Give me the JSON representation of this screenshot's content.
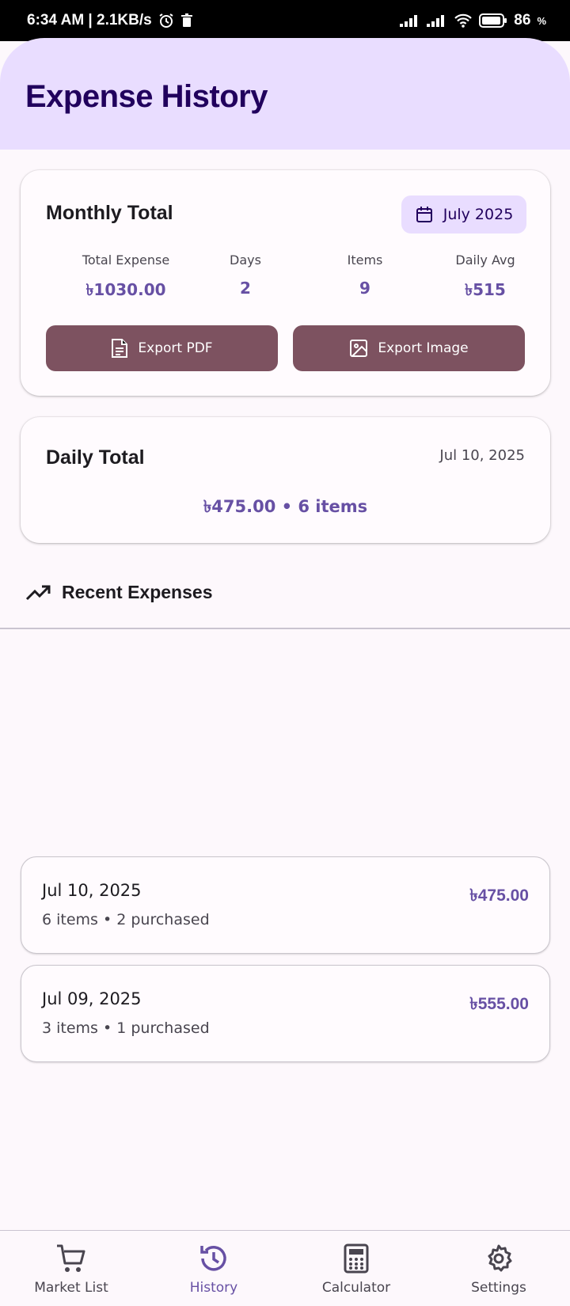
{
  "status_bar": {
    "time": "6:34 AM | 2.1KB/s",
    "battery": "86"
  },
  "header": {
    "title": "Expense History"
  },
  "monthly": {
    "title": "Monthly Total",
    "month": "July 2025",
    "stats": [
      {
        "label": "Total Expense",
        "value": "৳1030.00"
      },
      {
        "label": "Days",
        "value": "2"
      },
      {
        "label": "Items",
        "value": "9"
      },
      {
        "label": "Daily Avg",
        "value": "৳515"
      }
    ],
    "export_pdf": "Export PDF",
    "export_image": "Export Image"
  },
  "daily": {
    "title": "Daily Total",
    "date": "Jul 10, 2025",
    "summary": "৳475.00 • 6 items"
  },
  "recent": {
    "title": "Recent Expenses",
    "items": [
      {
        "date": "Jul 10, 2025",
        "meta": "6 items • 2 purchased",
        "amount": "৳475.00"
      },
      {
        "date": "Jul 09, 2025",
        "meta": "3 items • 1 purchased",
        "amount": "৳555.00"
      }
    ]
  },
  "nav": [
    {
      "label": "Market List",
      "icon": "cart-icon"
    },
    {
      "label": "History",
      "icon": "history-icon",
      "active": true
    },
    {
      "label": "Calculator",
      "icon": "calculator-icon"
    },
    {
      "label": "Settings",
      "icon": "gear-icon"
    }
  ],
  "colors": {
    "primary": "#6750a4",
    "header_bg": "#e9ddff",
    "export_button": "#7d5260"
  }
}
